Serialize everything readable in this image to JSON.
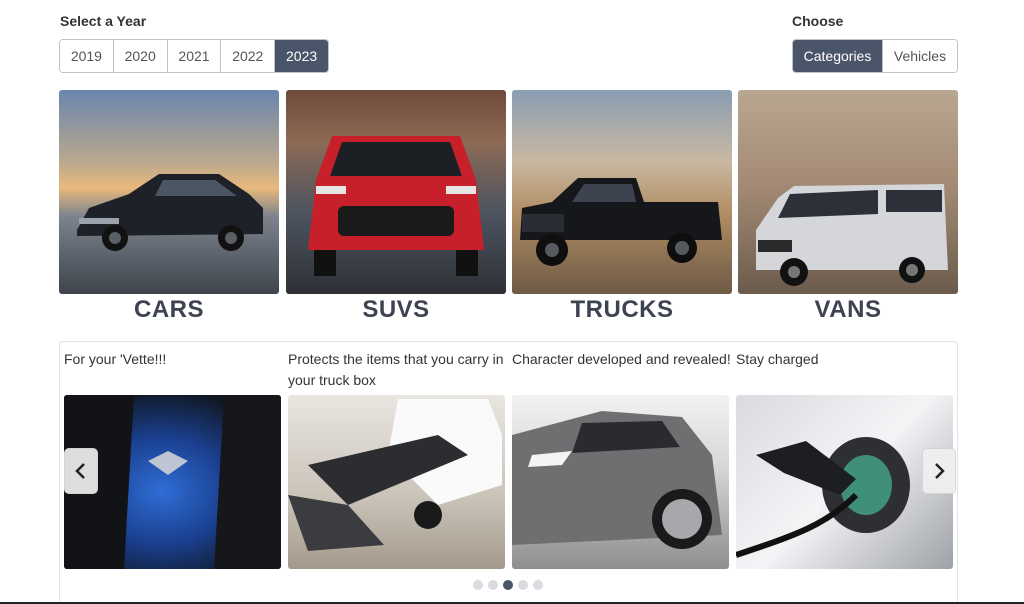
{
  "year_selector": {
    "label": "Select a Year",
    "options": [
      "2019",
      "2020",
      "2021",
      "2022",
      "2023"
    ],
    "selected": "2023"
  },
  "choose": {
    "label": "Choose",
    "options": [
      "Categories",
      "Vehicles"
    ],
    "selected": "Categories"
  },
  "categories": [
    {
      "title": "CARS"
    },
    {
      "title": "SUVS"
    },
    {
      "title": "TRUCKS"
    },
    {
      "title": "VANS"
    }
  ],
  "carousel": {
    "slides": [
      {
        "caption": "For your 'Vette!!!"
      },
      {
        "caption": "Protects the items that you carry in your truck box"
      },
      {
        "caption": "Character developed and revealed!"
      },
      {
        "caption": "Stay charged"
      }
    ],
    "dot_count": 5,
    "active_dot": 3
  },
  "colors": {
    "active_button": "#4b5569",
    "heading_text": "#3d4350"
  }
}
